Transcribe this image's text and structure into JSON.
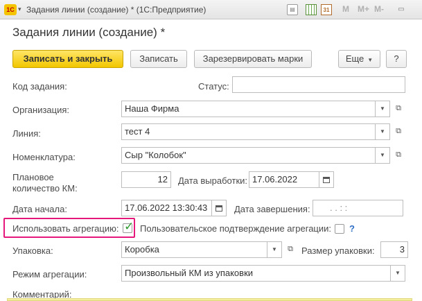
{
  "window": {
    "title": "Задания линии (создание) * (1С:Предприятие)",
    "logo_text": "1С",
    "toolbar_text": [
      "M",
      "M+",
      "M-"
    ]
  },
  "form": {
    "title": "Задания линии (создание) *"
  },
  "buttons": {
    "save_close": "Записать и закрыть",
    "save": "Записать",
    "reserve": "Зарезервировать марки",
    "more": "Еще",
    "help": "?"
  },
  "fields": {
    "task_code": {
      "label": "Код задания:",
      "value": ""
    },
    "status": {
      "label": "Статус:",
      "value": ""
    },
    "organization": {
      "label": "Организация:",
      "value": "Наша Фирма"
    },
    "line": {
      "label": "Линия:",
      "value": "тест 4"
    },
    "nomenclature": {
      "label": "Номенклатура:",
      "value": "Сыр \"Колобок\""
    },
    "planned_qty": {
      "label_1": "Плановое",
      "label_2": "количество КМ:",
      "value": "12"
    },
    "production_date": {
      "label": "Дата выработки:",
      "value": "17.06.2022"
    },
    "start_date": {
      "label": "Дата начала:",
      "value": "17.06.2022 13:30:43"
    },
    "end_date": {
      "label": "Дата завершения:",
      "value": ".  .     :  :"
    },
    "use_aggregation": {
      "label": "Использовать агрегацию:",
      "checked": true
    },
    "user_confirm": {
      "label": "Пользовательское подтверждение агрегации:",
      "checked": false,
      "help": "?"
    },
    "package": {
      "label": "Упаковка:",
      "value": "Коробка"
    },
    "package_size": {
      "label": "Размер упаковки:",
      "value": "3"
    },
    "aggregation_mode": {
      "label": "Режим агрегации:",
      "value": "Произвольный КМ из упаковки"
    },
    "comment": {
      "label": "Комментарий:"
    }
  }
}
